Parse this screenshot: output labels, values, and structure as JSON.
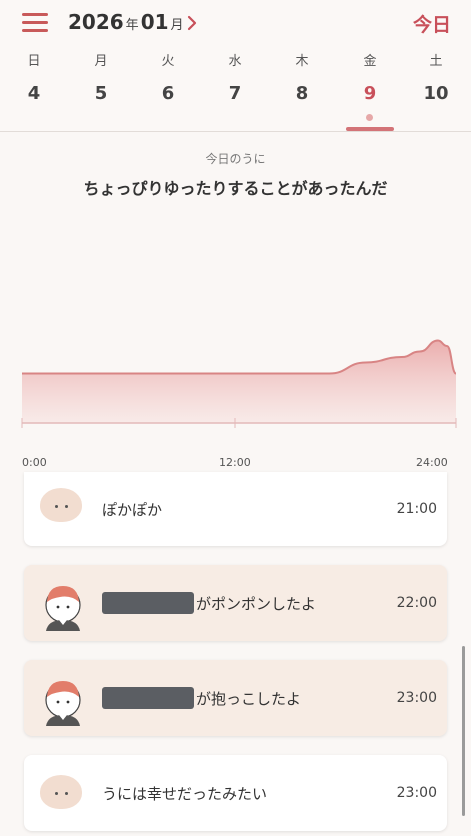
{
  "header": {
    "year": "2026",
    "year_unit": "年",
    "month": "01",
    "month_unit": "月",
    "today_label": "今日",
    "accent": "#c8505a"
  },
  "week": [
    {
      "dow": "日",
      "num": "4"
    },
    {
      "dow": "月",
      "num": "5"
    },
    {
      "dow": "火",
      "num": "6"
    },
    {
      "dow": "水",
      "num": "7"
    },
    {
      "dow": "木",
      "num": "8"
    },
    {
      "dow": "金",
      "num": "9",
      "selected": true
    },
    {
      "dow": "土",
      "num": "10"
    }
  ],
  "mood": {
    "subtitle": "今日のうに",
    "title": "ちょっぴりゆったりすることがあったんだ"
  },
  "chart_data": {
    "type": "area",
    "x_ticks": [
      "0:00",
      "12:00",
      "24:00"
    ],
    "xlim": [
      0,
      24
    ],
    "series": [
      {
        "x": [
          0,
          3,
          6,
          9,
          12,
          15,
          17,
          19,
          21,
          22,
          23,
          23.5,
          24
        ],
        "values": [
          0.45,
          0.45,
          0.45,
          0.45,
          0.45,
          0.45,
          0.45,
          0.55,
          0.6,
          0.65,
          0.75,
          0.7,
          0.45
        ]
      }
    ],
    "color": "#d98a8a"
  },
  "timeline": [
    {
      "avatar": "blob",
      "text": "ぽかぽか",
      "redacted": false,
      "time": "21:00",
      "tinted": false
    },
    {
      "avatar": "person",
      "text": "がポンポンしたよ",
      "redacted": true,
      "time": "22:00",
      "tinted": true
    },
    {
      "avatar": "person",
      "text": "が抱っこしたよ",
      "redacted": true,
      "time": "23:00",
      "tinted": true
    },
    {
      "avatar": "blob",
      "text": "うには幸せだったみたい",
      "redacted": false,
      "time": "23:00",
      "tinted": false
    }
  ]
}
